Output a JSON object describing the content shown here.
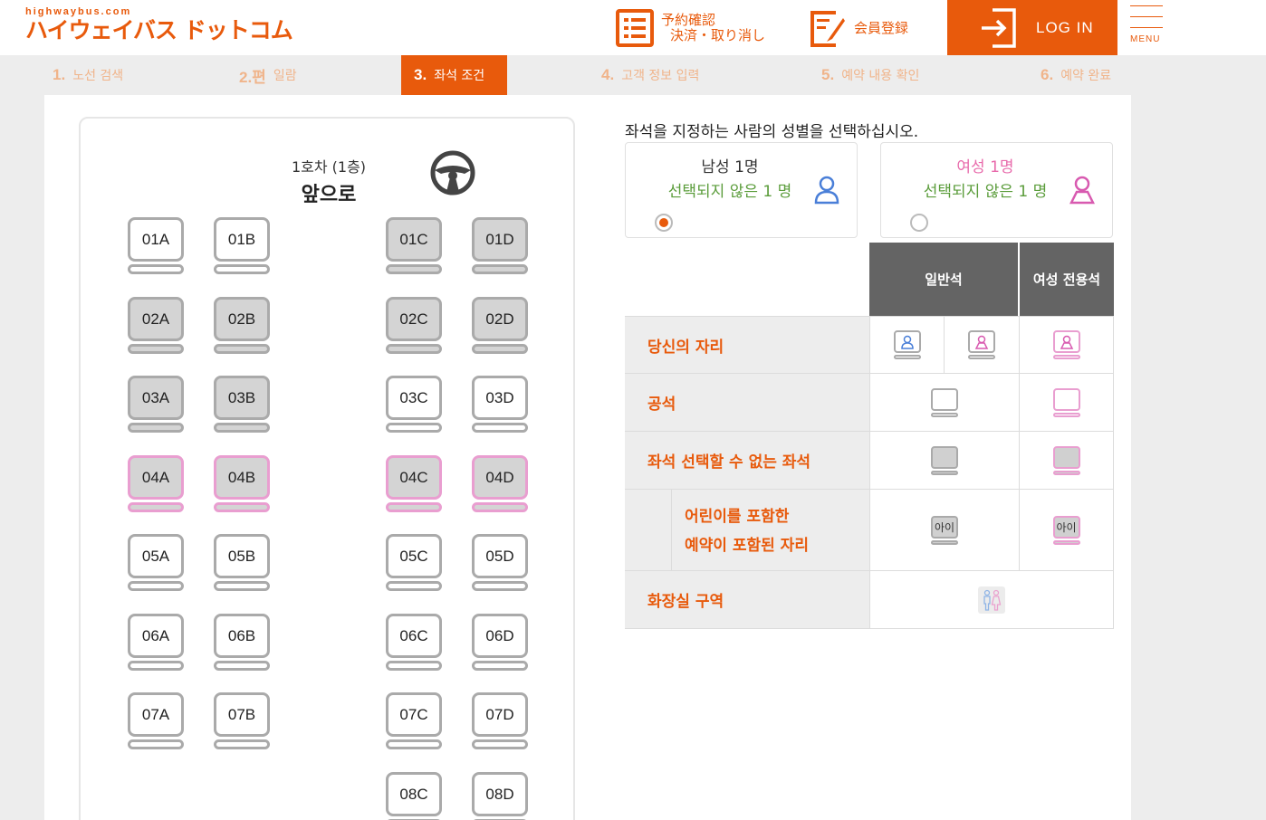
{
  "header": {
    "logo_small": "highwaybus.com",
    "logo_main": "ハイウェイバス ドットコム",
    "reservation_line1": "予約確認",
    "reservation_line2": "決済・取り消し",
    "member_label": "会員登録",
    "login_label": "LOG IN",
    "menu_label": "MENU"
  },
  "steps": [
    {
      "num": "1.",
      "label": "노선 검색"
    },
    {
      "num": "2.편",
      "label": "일람"
    },
    {
      "num": "3.",
      "label": "좌석 조건"
    },
    {
      "num": "4.",
      "label": "고객 정보 입력"
    },
    {
      "num": "5.",
      "label": "예약 내용 확인"
    },
    {
      "num": "6.",
      "label": "예약 완료"
    }
  ],
  "active_step_index": 2,
  "seatmap": {
    "car_name": "1호차 (1층)",
    "front_label": "앞으로",
    "seats": {
      "r1": [
        "01A",
        "01B",
        "01C",
        "01D"
      ],
      "r2": [
        "02A",
        "02B",
        "02C",
        "02D"
      ],
      "r3": [
        "03A",
        "03B",
        "03C",
        "03D"
      ],
      "r4": [
        "04A",
        "04B",
        "04C",
        "04D"
      ],
      "r5": [
        "05A",
        "05B",
        "05C",
        "05D"
      ],
      "r6": [
        "06A",
        "06B",
        "06C",
        "06D"
      ],
      "r7": [
        "07A",
        "07B",
        "07C",
        "07D"
      ],
      "r8": [
        "08C",
        "08D"
      ]
    },
    "taken_seats": [
      "01C",
      "01D",
      "02A",
      "02B",
      "02C",
      "02D",
      "03A",
      "03B",
      "04A",
      "04B",
      "04C",
      "04D"
    ],
    "female_seats": [
      "04A",
      "04B",
      "04C",
      "04D"
    ]
  },
  "gender_select": {
    "instruction": "좌석을 지정하는 사람의 성별을 선택하십시오.",
    "male": {
      "label": "남성 1명",
      "status": "선택되지 않은 1 명",
      "selected": true,
      "color": "#333333",
      "icon": "male-person-icon",
      "icon_color": "#4a7fd8"
    },
    "female": {
      "label": "여성 1명",
      "status": "선택되지 않은 1 명",
      "selected": false,
      "color": "#e86aab",
      "icon": "female-person-icon",
      "icon_color": "#d85ab0"
    }
  },
  "legend": {
    "col_general": "일반석",
    "col_female": "여성 전용석",
    "rows": {
      "your_seat": "당신의 자리",
      "vacant": "공석",
      "unselectable": "좌석 선택할 수 없는 좌석",
      "child_line1": "어린이를 포함한",
      "child_line2": "예약이 포함된 자리",
      "restroom": "화장실 구역"
    },
    "child_mark": "아이",
    "restroom_icon": "restroom-icon"
  },
  "colors": {
    "brand": "#e85a0c",
    "female_accent": "#e99ed0",
    "taken_seat": "#d4d4d4",
    "status_green": "#5a9c3a"
  }
}
